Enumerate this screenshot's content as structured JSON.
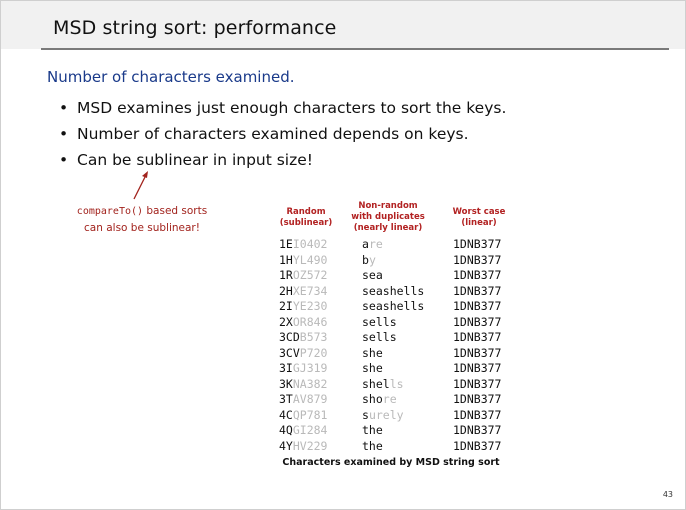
{
  "slide": {
    "title": "MSD string sort:  performance",
    "subheading": "Number of characters examined.",
    "bullets": [
      "MSD examines just enough characters to sort the keys.",
      "Number of characters examined depends on keys.",
      "Can be sublinear in input size!"
    ],
    "note": {
      "code": "compareTo()",
      "line1_rest": " based sorts",
      "line2": "can also be sublinear!"
    },
    "page_number": "43"
  },
  "table": {
    "headers": [
      {
        "line1": "Random",
        "line2": "(sublinear)"
      },
      {
        "line1": "Non-random",
        "line2": "with duplicates",
        "line3": "(nearly linear)"
      },
      {
        "line1": "Worst case",
        "line2": "(linear)"
      }
    ],
    "random": [
      [
        "1E",
        "I0402"
      ],
      [
        "1H",
        "YL490"
      ],
      [
        "1R",
        "OZ572"
      ],
      [
        "2H",
        "XE734"
      ],
      [
        "2I",
        "YE230"
      ],
      [
        "2X",
        "OR846"
      ],
      [
        "3CD",
        "B573"
      ],
      [
        "3CV",
        "P720"
      ],
      [
        "3I",
        "GJ319"
      ],
      [
        "3K",
        "NA382"
      ],
      [
        "3T",
        "AV879"
      ],
      [
        "4C",
        "QP781"
      ],
      [
        "4Q",
        "GI284"
      ],
      [
        "4Y",
        "HV229"
      ]
    ],
    "nonrandom": [
      [
        "a",
        "re"
      ],
      [
        "b",
        "y"
      ],
      [
        "sea",
        ""
      ],
      [
        "seashells",
        ""
      ],
      [
        "seashells",
        ""
      ],
      [
        "sells",
        ""
      ],
      [
        "sells",
        ""
      ],
      [
        "she",
        ""
      ],
      [
        "she",
        ""
      ],
      [
        "shel",
        "ls"
      ],
      [
        "sho",
        "re"
      ],
      [
        "s",
        "urely"
      ],
      [
        "the",
        ""
      ],
      [
        "the",
        ""
      ]
    ],
    "worst": [
      "1DNB377",
      "1DNB377",
      "1DNB377",
      "1DNB377",
      "1DNB377",
      "1DNB377",
      "1DNB377",
      "1DNB377",
      "1DNB377",
      "1DNB377",
      "1DNB377",
      "1DNB377",
      "1DNB377",
      "1DNB377"
    ],
    "caption": "Characters examined by MSD string sort"
  },
  "colors": {
    "subheading": "#1a3a8a",
    "accent_red": "#b22222",
    "unexamined_gray": "#b9b9b9"
  }
}
